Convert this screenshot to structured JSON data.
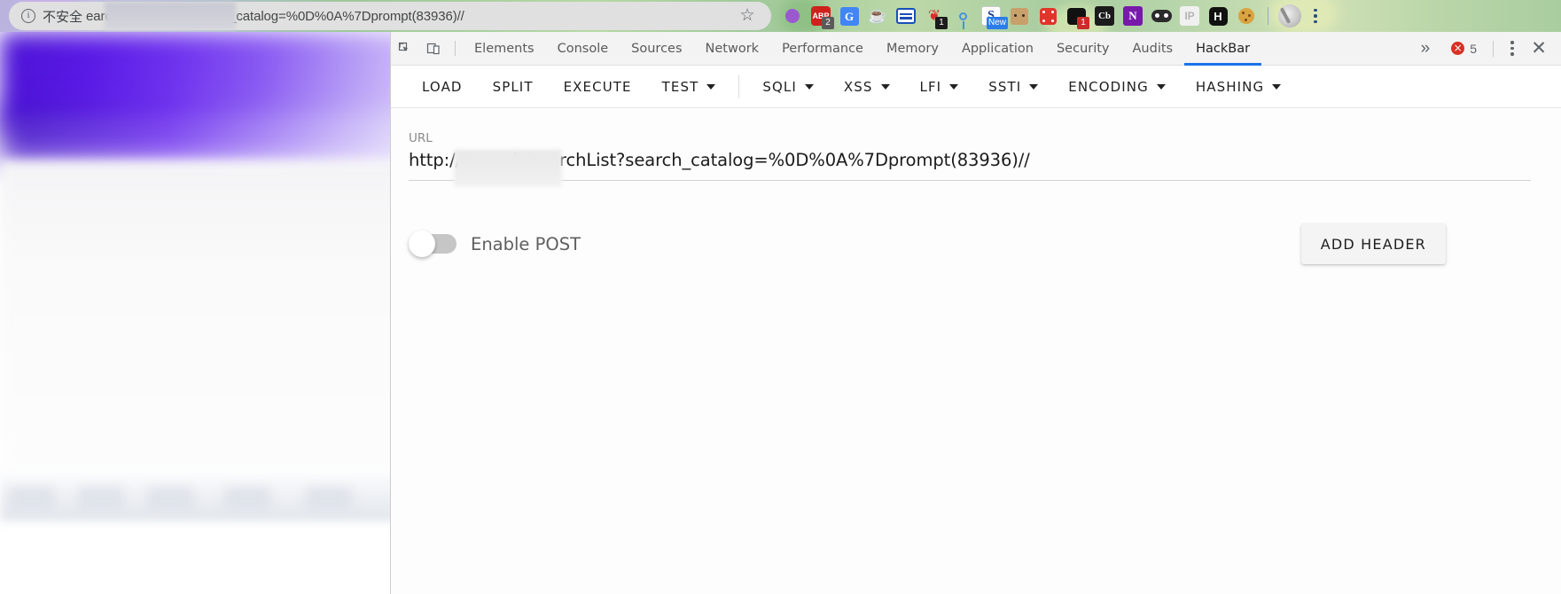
{
  "browser": {
    "security_label": "不安全",
    "omnibox_url": "earch/searchList?search_catalog=%0D%0A%7Dprompt(83936)//",
    "bookmark_icon": "star-outline-icon",
    "security_icon": "info-circle-icon",
    "extensions": [
      {
        "name": "purple-dot-extension-icon",
        "glyph": "●",
        "color": "#9b59d0",
        "badge": ""
      },
      {
        "name": "adblock-plus-icon",
        "glyph": "ABP",
        "color": "#ffffff",
        "badge": "2",
        "badge_style": "gray"
      },
      {
        "name": "google-translate-icon",
        "glyph": "G",
        "color": "#ffffff",
        "badge": ""
      },
      {
        "name": "java-icon",
        "glyph": "☕",
        "color": "#e76f00",
        "badge": ""
      },
      {
        "name": "reader-document-icon",
        "glyph": "▤",
        "color": "#1a73e8",
        "badge": ""
      },
      {
        "name": "red-clip-icon",
        "glyph": "❦",
        "color": "#e02b2b",
        "badge": "1",
        "badge_style": "dark"
      },
      {
        "name": "location-pin-icon",
        "glyph": "♀",
        "color": "#4a90d9",
        "badge": ""
      },
      {
        "name": "new-badge-extension-icon",
        "glyph": "S",
        "color": "#ffffff",
        "badge": "New",
        "badge_style": "blue"
      },
      {
        "name": "robot-box-icon",
        "glyph": "▣",
        "color": "#c8a06a",
        "badge": ""
      },
      {
        "name": "red-dice-icon",
        "glyph": "⚅",
        "color": "#e0352b",
        "badge": ""
      },
      {
        "name": "black-shape-icon",
        "glyph": "◖",
        "color": "#111111",
        "badge": "1",
        "badge_style": "red"
      },
      {
        "name": "cb-extension-icon",
        "glyph": "Cb",
        "color": "#ffffff",
        "badge": ""
      },
      {
        "name": "onenote-icon",
        "glyph": "N",
        "color": "#ffffff",
        "badge": ""
      },
      {
        "name": "mask-incognito-icon",
        "glyph": "◑",
        "color": "#2b2b2b",
        "badge": ""
      },
      {
        "name": "ip-lookup-icon",
        "glyph": "IP",
        "color": "#c8c8c8",
        "badge": ""
      },
      {
        "name": "h-extension-icon",
        "glyph": "H",
        "color": "#ffffff",
        "badge": ""
      },
      {
        "name": "cookie-editor-icon",
        "glyph": "●",
        "color": "#d9a441",
        "badge": ""
      }
    ],
    "avatar": "profile-avatar",
    "menu_icon": "chrome-menu-kebab-icon"
  },
  "devtools": {
    "inspect_icon": "inspect-element-icon",
    "device_toolbar_icon": "device-toolbar-icon",
    "tabs": [
      {
        "label": "Elements",
        "active": false
      },
      {
        "label": "Console",
        "active": false
      },
      {
        "label": "Sources",
        "active": false
      },
      {
        "label": "Network",
        "active": false
      },
      {
        "label": "Performance",
        "active": false
      },
      {
        "label": "Memory",
        "active": false
      },
      {
        "label": "Application",
        "active": false
      },
      {
        "label": "Security",
        "active": false
      },
      {
        "label": "Audits",
        "active": false
      },
      {
        "label": "HackBar",
        "active": true
      }
    ],
    "overflow_label": "»",
    "error_count": "5",
    "error_icon": "error-circle-icon",
    "error_glyph": "×",
    "settings_icon": "devtools-kebab-icon",
    "close_icon": "close-icon",
    "close_glyph": "✕",
    "accent_color": "#1a73e8",
    "error_color": "#d93025"
  },
  "hackbar": {
    "actions": [
      {
        "label": "LOAD",
        "dropdown": false
      },
      {
        "label": "SPLIT",
        "dropdown": false
      },
      {
        "label": "EXECUTE",
        "dropdown": false
      },
      {
        "label": "TEST",
        "dropdown": true
      }
    ],
    "payloads": [
      {
        "label": "SQLI",
        "dropdown": true
      },
      {
        "label": "XSS",
        "dropdown": true
      },
      {
        "label": "LFI",
        "dropdown": true
      },
      {
        "label": "SSTI",
        "dropdown": true
      },
      {
        "label": "ENCODING",
        "dropdown": true
      },
      {
        "label": "HASHING",
        "dropdown": true
      }
    ],
    "url_label": "URL",
    "url_prefix": "http://",
    "url_suffix": "/search/searchList?search_catalog=%0D%0A%7Dprompt(83936)//",
    "post_toggle_label": "Enable POST",
    "post_toggle_state": "off",
    "add_header_label": "ADD HEADER"
  }
}
